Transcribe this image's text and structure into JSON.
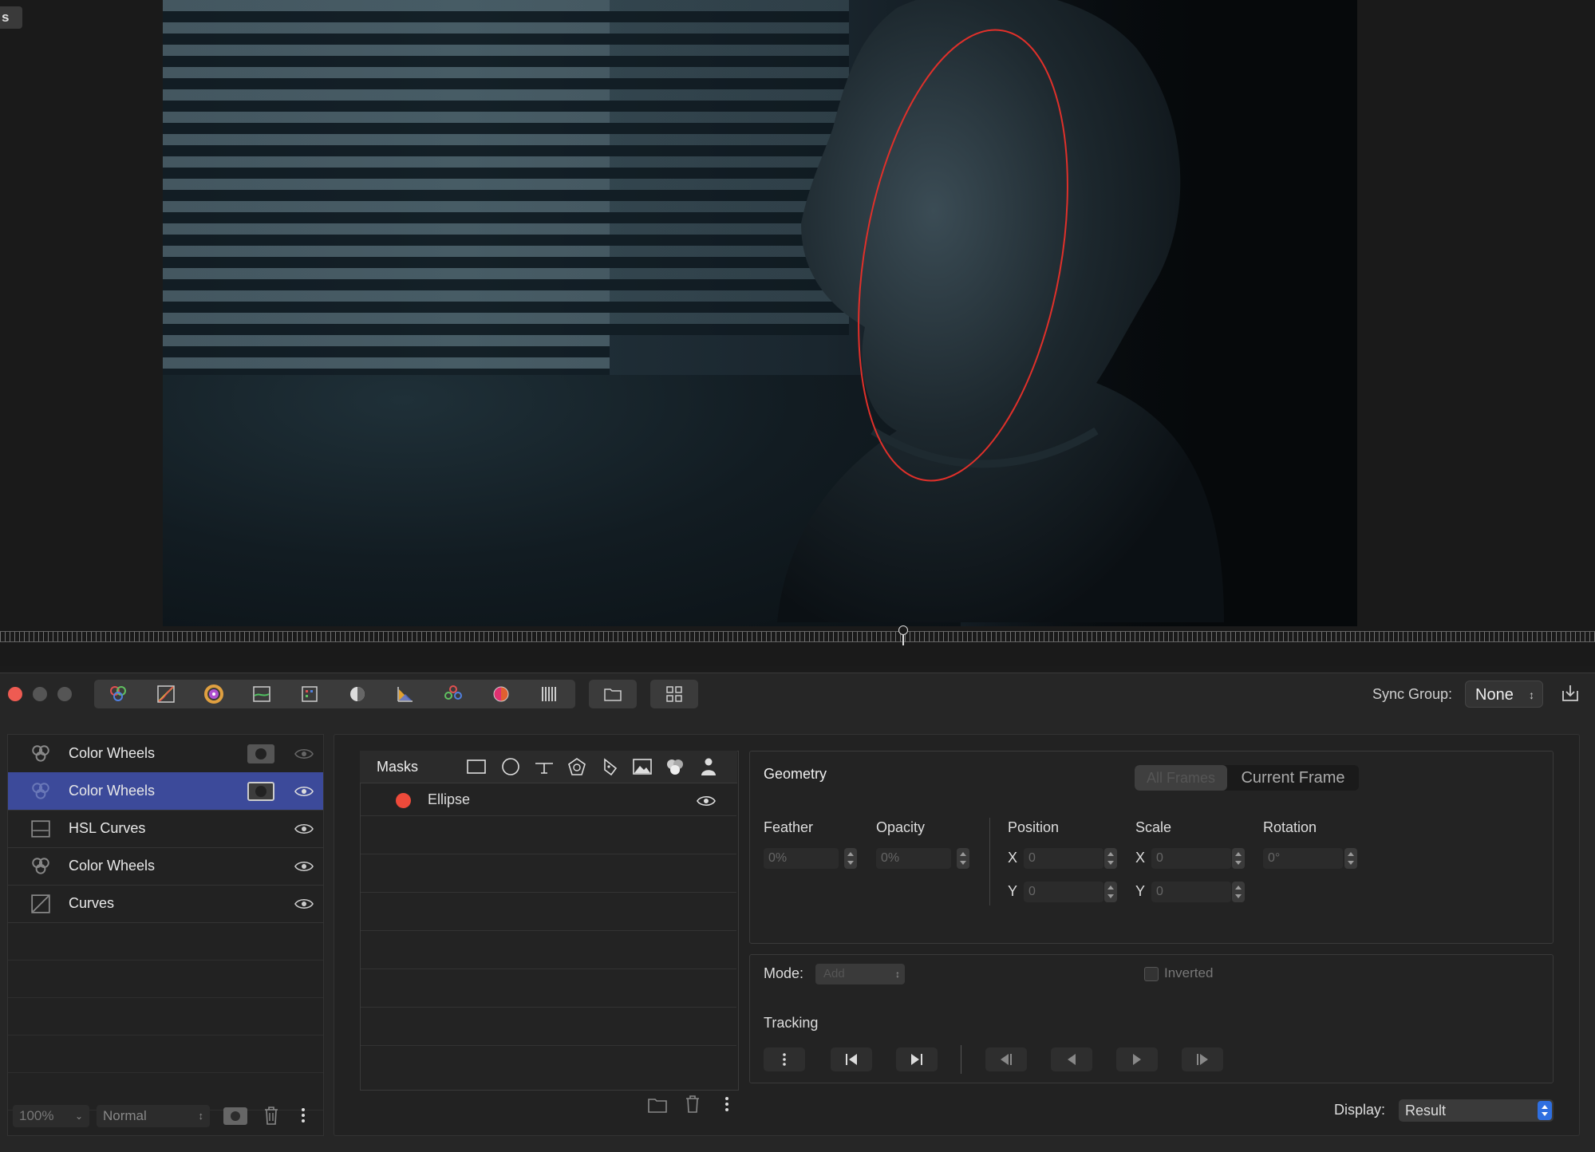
{
  "viewer": {
    "corner_tag": "s"
  },
  "toolbar": {
    "tools": [
      "color-wheels-icon",
      "curves-icon",
      "color-circle-icon",
      "hsl-curves-icon",
      "color-table-icon",
      "color-balance-icon",
      "rgb-parade-icon",
      "color-board-icon",
      "saturation-icon",
      "barcode-icon"
    ],
    "sync_group_label": "Sync Group:",
    "sync_group_value": "None",
    "accent_close": "#ee5b52"
  },
  "layers": {
    "items": [
      {
        "label": "Color Wheels",
        "icon": "color-wheels-icon",
        "has_mask": true,
        "selected": false
      },
      {
        "label": "Color Wheels",
        "icon": "color-wheels-icon",
        "has_mask": true,
        "selected": true
      },
      {
        "label": "HSL Curves",
        "icon": "hsl-curves-icon",
        "has_mask": false,
        "selected": false
      },
      {
        "label": "Color Wheels",
        "icon": "color-wheels-icon",
        "has_mask": false,
        "selected": false
      },
      {
        "label": "Curves",
        "icon": "curves-icon",
        "has_mask": false,
        "selected": false
      }
    ],
    "selection_color": "#3c4a9a",
    "zoom_value": "100%",
    "blend_mode": "Normal"
  },
  "masks": {
    "title": "Masks",
    "tools": [
      "rectangle-mask-icon",
      "ellipse-mask-icon",
      "gradient-mask-icon",
      "polygon-mask-icon",
      "pen-mask-icon",
      "luminance-mask-icon",
      "color-mask-icon",
      "person-mask-icon"
    ],
    "items": [
      {
        "label": "Ellipse",
        "color": "#ee4a3a"
      }
    ]
  },
  "geometry": {
    "title": "Geometry",
    "seg_all": "All Frames",
    "seg_current": "Current Frame",
    "feather_label": "Feather",
    "feather_value": "0%",
    "opacity_label": "Opacity",
    "opacity_value": "0%",
    "position_label": "Position",
    "position_x": "0",
    "position_y": "0",
    "scale_label": "Scale",
    "scale_x": "0",
    "scale_y": "0",
    "rotation_label": "Rotation",
    "rotation_value": "0°",
    "x_label": "X",
    "y_label": "Y"
  },
  "mode": {
    "label": "Mode:",
    "value": "Add",
    "inverted_label": "Inverted",
    "inverted_checked": false
  },
  "tracking": {
    "label": "Tracking"
  },
  "display": {
    "label": "Display:",
    "value": "Result",
    "accent": "#2f6fe0"
  }
}
